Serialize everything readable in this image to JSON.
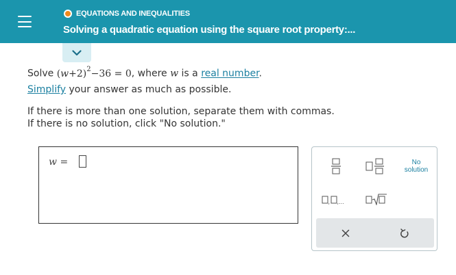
{
  "header": {
    "topic": "EQUATIONS AND INEQUALITIES",
    "title": "Solving a quadratic equation using the square root property:..."
  },
  "question": {
    "prompt_prefix": "Solve ",
    "equation": {
      "open": "(",
      "var": "w",
      "plus_term": "+2)",
      "exponent": "2",
      "rest": "−36 = 0",
      "trailing": ","
    },
    "where_prefix": " where ",
    "where_var": "w",
    "where_middle": " is a ",
    "where_link": "real number",
    "where_end": ".",
    "simplify_link": "Simplify",
    "simplify_rest": " your answer as much as possible.",
    "instr_1": "If there is more than one solution, separate them with commas.",
    "instr_2": "If there is no solution, click \"No solution.\""
  },
  "answer": {
    "var": "w",
    "equals": "="
  },
  "keypad": {
    "no_solution": "No solution",
    "multiple_answers": "□,□,..."
  }
}
